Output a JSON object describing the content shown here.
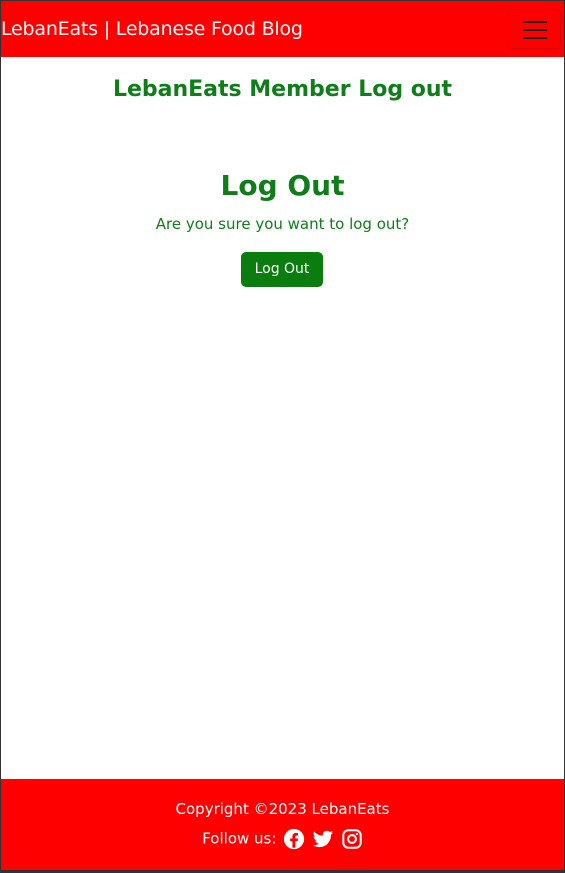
{
  "navbar": {
    "brand": "LebanEats | Lebanese Food Blog",
    "menu_icon": "hamburger-menu-icon",
    "background_color": "#ff0000"
  },
  "main": {
    "page_heading": "LebanEats Member Log out",
    "title": "Log Out",
    "confirm_text": "Are you sure you want to log out?",
    "logout_button_label": "Log Out",
    "accent_color": "#0f7d1a",
    "button_color": "#0a7d0e"
  },
  "footer": {
    "copyright": "Copyright ©2023 LebanEats",
    "follow_label": "Follow us:",
    "social_icons": [
      "facebook-icon",
      "twitter-icon",
      "instagram-icon"
    ],
    "background_color": "#ff0000"
  }
}
